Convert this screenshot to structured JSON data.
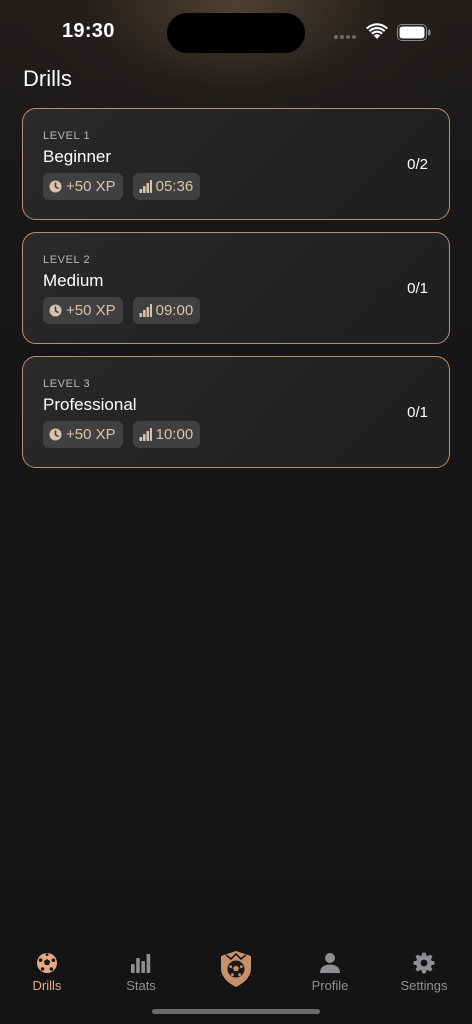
{
  "status_bar": {
    "time": "19:30"
  },
  "page": {
    "title": "Drills"
  },
  "drills": [
    {
      "level": "LEVEL 1",
      "name": "Beginner",
      "xp": "+50 XP",
      "duration": "05:36",
      "progress": "0/2"
    },
    {
      "level": "LEVEL 2",
      "name": "Medium",
      "xp": "+50 XP",
      "duration": "09:00",
      "progress": "0/1"
    },
    {
      "level": "LEVEL 3",
      "name": "Professional",
      "xp": "+50 XP",
      "duration": "10:00",
      "progress": "0/1"
    }
  ],
  "tabbar": {
    "drills": "Drills",
    "stats": "Stats",
    "profile": "Profile",
    "settings": "Settings"
  },
  "colors": {
    "accent": "#e9a883",
    "card_border": "#b9906a",
    "chip_text": "#d8c3ae",
    "inactive": "#8e8e93"
  }
}
